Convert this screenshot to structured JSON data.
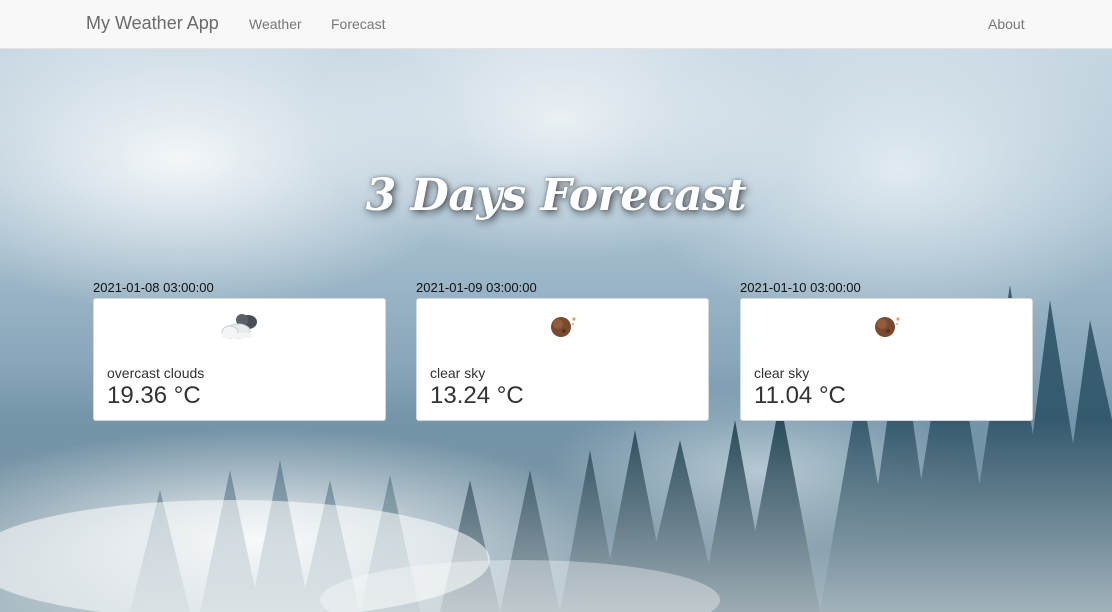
{
  "navbar": {
    "brand": "My Weather App",
    "links": {
      "weather": "Weather",
      "forecast": "Forecast",
      "about": "About"
    }
  },
  "heading": "3 Days Forecast",
  "forecast": [
    {
      "date": "2021-01-08 03:00:00",
      "icon": "overcast-clouds-icon",
      "description": "overcast clouds",
      "temperature": "19.36 °C"
    },
    {
      "date": "2021-01-09 03:00:00",
      "icon": "clear-sky-night-icon",
      "description": "clear sky",
      "temperature": "13.24 °C"
    },
    {
      "date": "2021-01-10 03:00:00",
      "icon": "clear-sky-night-icon",
      "description": "clear sky",
      "temperature": "11.04 °C"
    }
  ],
  "colors": {
    "navbar_bg": "#f8f8f8",
    "card_bg": "#ffffff",
    "text": "#333333"
  }
}
